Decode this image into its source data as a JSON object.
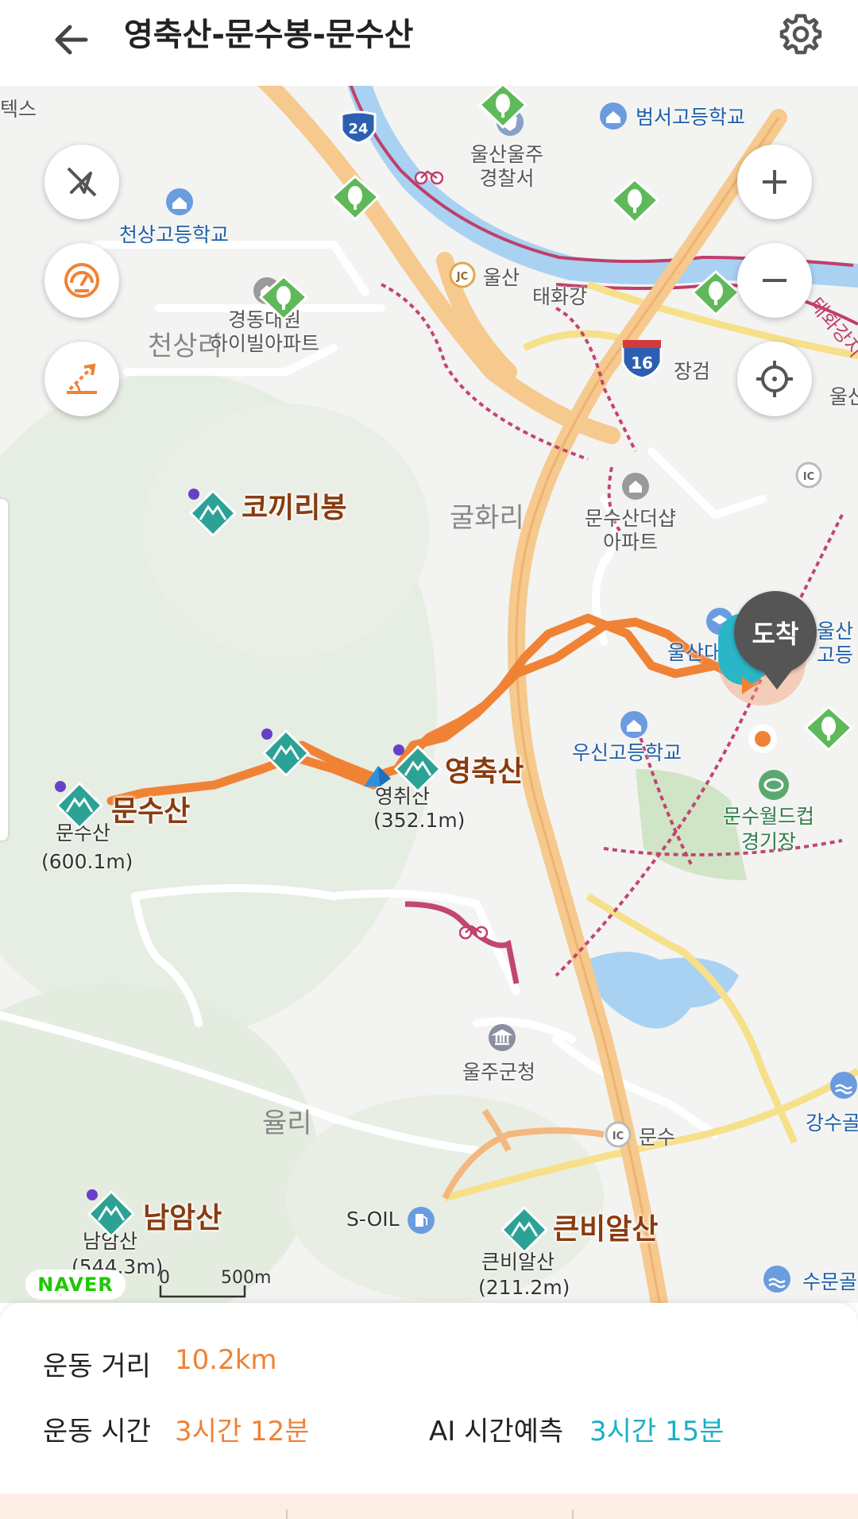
{
  "header": {
    "title": "영축산-문수봉-문수산"
  },
  "map": {
    "labels": {
      "teks": "텍스",
      "beomseo_school": "범서고등학교",
      "police": "울산울주\n경찰서",
      "cheonsang_school": "천상고등학교",
      "jc_ulsan": "울산",
      "taehwa_river": "태화강",
      "taehwa_right": "태화강지",
      "cheonsangri": "천상리",
      "gyeongdong_apt": "경동대원\n하이빌아파트",
      "janggeom": "장검",
      "ic_ulsan": "울산",
      "kokkiribong": "코끼리봉",
      "gulhwari": "굴화리",
      "munsu_the_apt": "문수산더샵\n아파트",
      "ulsan_e": "울산대",
      "ulsan_hs": "울산\n고등",
      "yeongchuksan": "영축산",
      "yeongchwi_name": "영취산",
      "yeongchwi_h": "(352.1m)",
      "usin_school": "우신고등학교",
      "munsusan": "문수산",
      "munsusan_name": "문수산",
      "munsusan_h": "(600.1m)",
      "worldcup": "문수월드컵\n경기장",
      "uljugun": "울주군청",
      "yulli": "율리",
      "ic_munsu": "문수",
      "gangsu": "강수골",
      "namamsan": "남암산",
      "namamsan_name": "남암산",
      "namamsan_h": "(544.3m)",
      "soil": "S-OIL",
      "keunbialsan": "큰비알산",
      "keunbialsan_name": "큰비알산",
      "keunbialsan_h": "(211.2m)",
      "sumungol": "수문골",
      "route24": "24",
      "route16": "16",
      "jc": "JC",
      "ic": "IC"
    },
    "arrive_label": "도착",
    "naver": "NAVER",
    "scale_zero": "0",
    "scale_label": "500m"
  },
  "stats": {
    "distance_label": "운동 거리",
    "distance_value": "10.2km",
    "time_label": "운동 시간",
    "time_value": "3시간 12분",
    "ai_label": "AI 시간예측",
    "ai_value": "3시간 15분"
  },
  "colors": {
    "route": "#f08236",
    "ai": "#1ab0c4",
    "highway": "#f6c98e",
    "river": "#a9d2f2",
    "rail": "#c24670"
  }
}
